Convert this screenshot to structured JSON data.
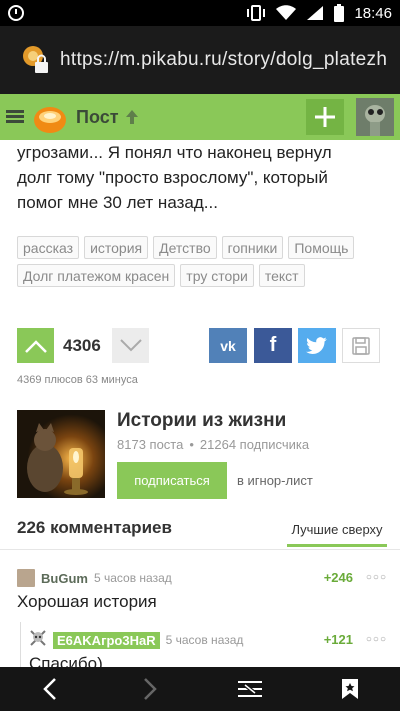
{
  "status_bar": {
    "time": "18:46"
  },
  "browser": {
    "url": "https://m.pikabu.ru/story/dolg_platezh"
  },
  "header": {
    "title": "Пост"
  },
  "post": {
    "text_line1": "угрозами... Я понял что наконец вернул",
    "text_line2": "долг тому \"просто взрослому\", который",
    "text_line3": "помог мне 30 лет назад...",
    "tags": [
      "рассказ",
      "история",
      "Детство",
      "гопники",
      "Помощь",
      "Долг платежом красен",
      "тру стори",
      "текст"
    ],
    "rating": "4306",
    "vote_stats": "4369 плюсов 63 минуса"
  },
  "share": {
    "vk": "vk",
    "fb": "f"
  },
  "community": {
    "name": "Истории из жизни",
    "posts": "8173 поста",
    "subscribers": "21264 подписчика",
    "subscribe_label": "подписаться",
    "ignore_label": "в игнор-лист"
  },
  "comments": {
    "count_label": "226 комментариев",
    "sort_label": "Лучшие сверху",
    "items": [
      {
        "author": "BuGum",
        "time": "5 часов назад",
        "rating": "+246",
        "text": "Хорошая история"
      },
      {
        "author": "E6AKAгpo3HaR",
        "time": "5 часов назад",
        "rating": "+121",
        "text": "Спасибо)"
      }
    ]
  },
  "colors": {
    "accent": "#8ac858",
    "vk": "#5181b8",
    "facebook": "#3b5998",
    "twitter": "#55acee"
  }
}
